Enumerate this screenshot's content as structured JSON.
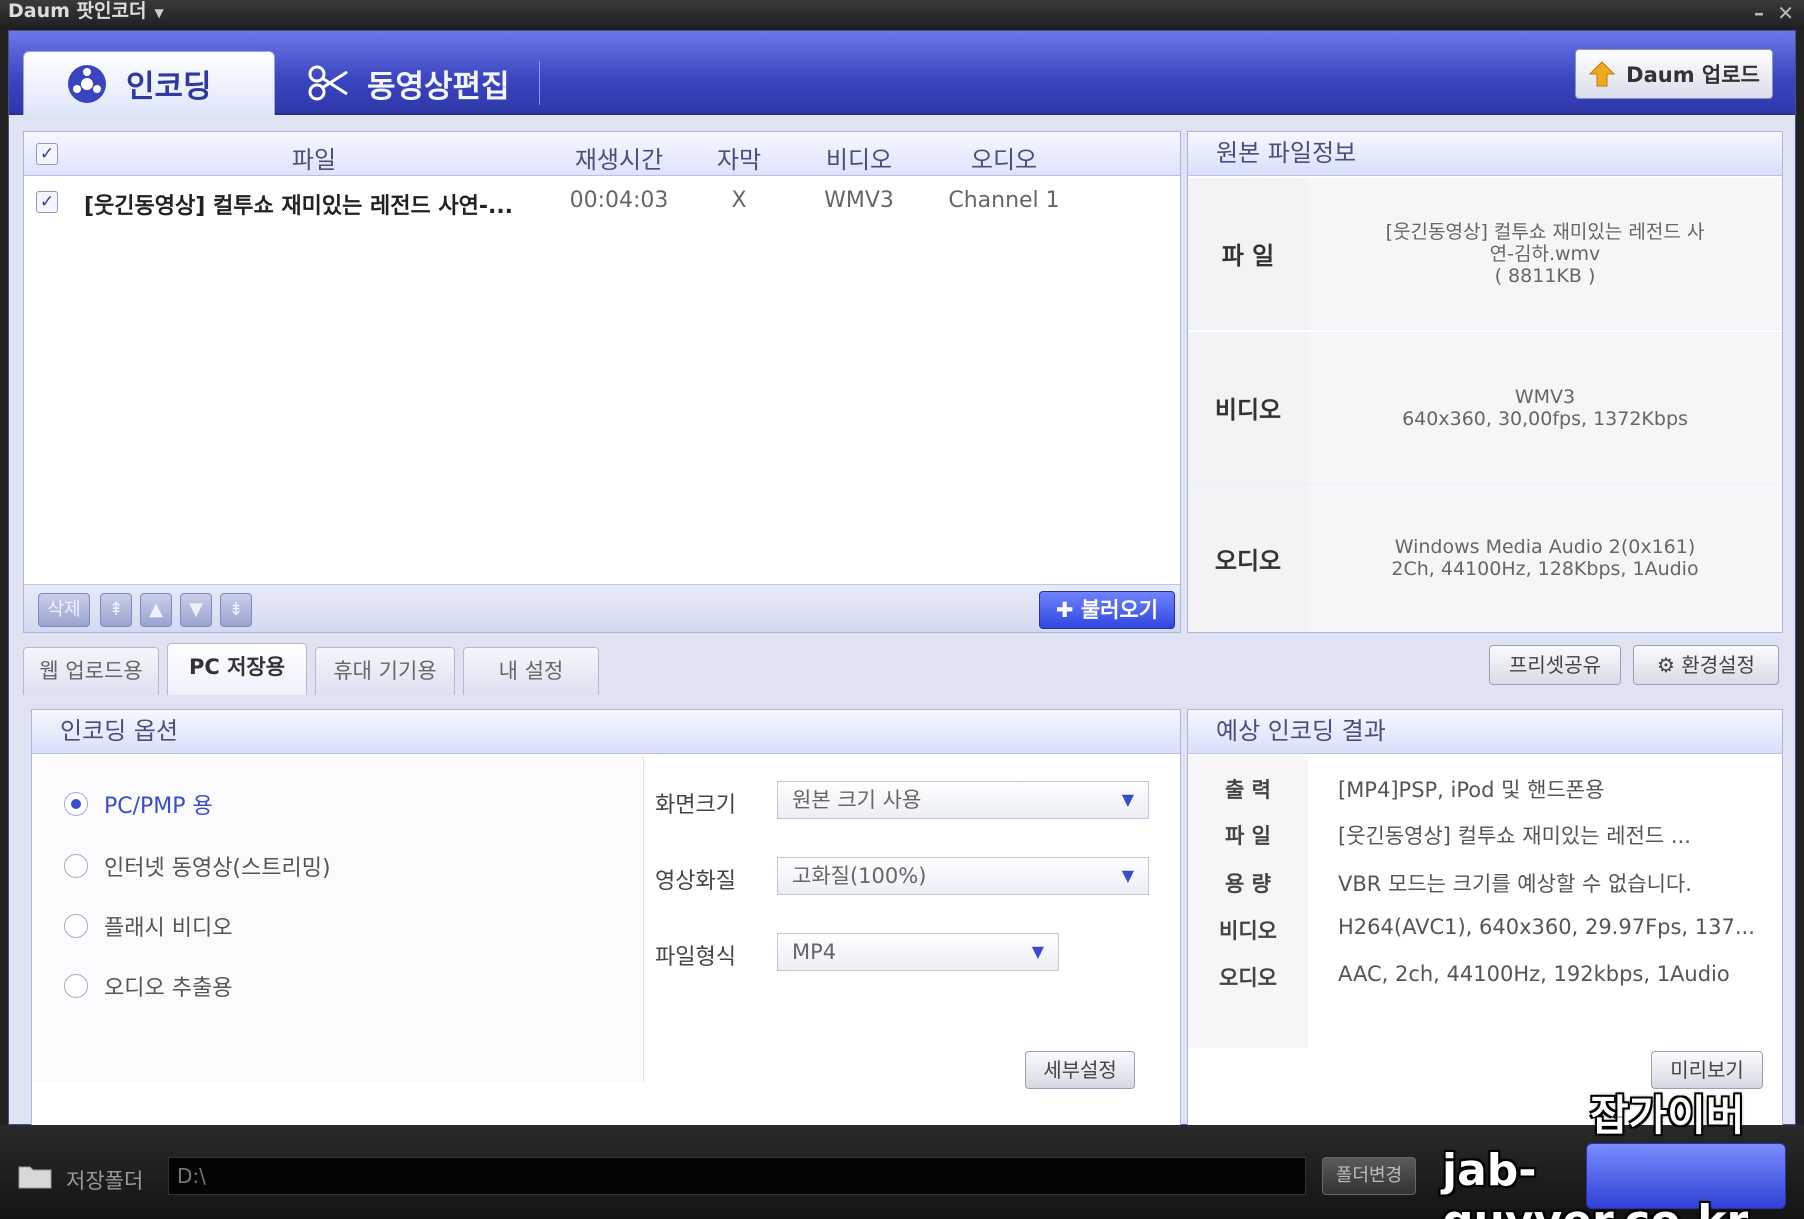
{
  "app": {
    "title": "Daum 팟인코더"
  },
  "main_tabs": [
    {
      "label": "인코딩",
      "active": true
    },
    {
      "label": "동영상편집",
      "active": false
    }
  ],
  "upload_button": {
    "label": "Daum 업로드"
  },
  "file_list": {
    "headers": {
      "file": "파일",
      "duration": "재생시간",
      "subtitle": "자막",
      "video": "비디오",
      "audio": "오디오"
    },
    "rows": [
      {
        "checked": true,
        "file": "[웃긴동영상] 컬투쇼 재미있는 레전드 사연-...",
        "duration": "00:04:03",
        "subtitle": "X",
        "video": "WMV3",
        "audio": "Channel 1"
      }
    ],
    "delete_label": "삭제",
    "fetch_label": "불러오기"
  },
  "source_info": {
    "title": "원본 파일정보",
    "file_label": "파  일",
    "file_name_line1": "[웃긴동영상] 컬투쇼 재미있는 레전드 사",
    "file_name_line2": "연-김하.wmv",
    "file_size": "( 8811KB )",
    "video_label": "비디오",
    "video_line1": "WMV3",
    "video_line2": "640x360, 30,00fps, 1372Kbps",
    "audio_label": "오디오",
    "audio_line1": "Windows Media Audio 2(0x161)",
    "audio_line2": "2Ch, 44100Hz, 128Kbps, 1Audio"
  },
  "sub_tabs": [
    {
      "label": "웹 업로드용",
      "active": false
    },
    {
      "label": "PC 저장용",
      "active": true
    },
    {
      "label": "휴대 기기용",
      "active": false
    },
    {
      "label": "내 설정",
      "active": false
    }
  ],
  "preset_share": {
    "label": "프리셋공유"
  },
  "settings": {
    "label": "환경설정"
  },
  "encoding_options": {
    "title": "인코딩 옵션",
    "radios": [
      {
        "label": "PC/PMP 용",
        "selected": true
      },
      {
        "label": "인터넷 동영상(스트리밍)",
        "selected": false
      },
      {
        "label": "플래시 비디오",
        "selected": false
      },
      {
        "label": "오디오 추출용",
        "selected": false
      }
    ],
    "screen_size_label": "화면크기",
    "screen_size_value": "원본 크기 사용",
    "quality_label": "영상화질",
    "quality_value": "고화질(100%)",
    "format_label": "파일형식",
    "format_value": "MP4",
    "detail_button": "세부설정"
  },
  "expected_result": {
    "title": "예상 인코딩 결과",
    "rows": [
      {
        "label": "출  력",
        "value": "[MP4]PSP, iPod 및 핸드폰용"
      },
      {
        "label": "파  일",
        "value": "[웃긴동영상] 컬투쇼 재미있는 레전드 ..."
      },
      {
        "label": "용  량",
        "value": "VBR 모드는 크기를 예상할 수 없습니다."
      },
      {
        "label": "비디오",
        "value": "H264(AVC1), 640x360, 29.97Fps, 137..."
      },
      {
        "label": "오디오",
        "value": "AAC, 2ch, 44100Hz, 192kbps, 1Audio"
      }
    ],
    "preview_button": "미리보기"
  },
  "bottom": {
    "folder_label": "저장폴더",
    "path_value": "D:\\",
    "change_button": "폴더변경"
  },
  "watermark": {
    "line1": "잡가이버",
    "line2": "jab-guyver.co.kr"
  },
  "colors": {
    "accent": "#3a44bf",
    "header_light": "#6d78e8",
    "selected_radio": "#3c4dc8"
  }
}
